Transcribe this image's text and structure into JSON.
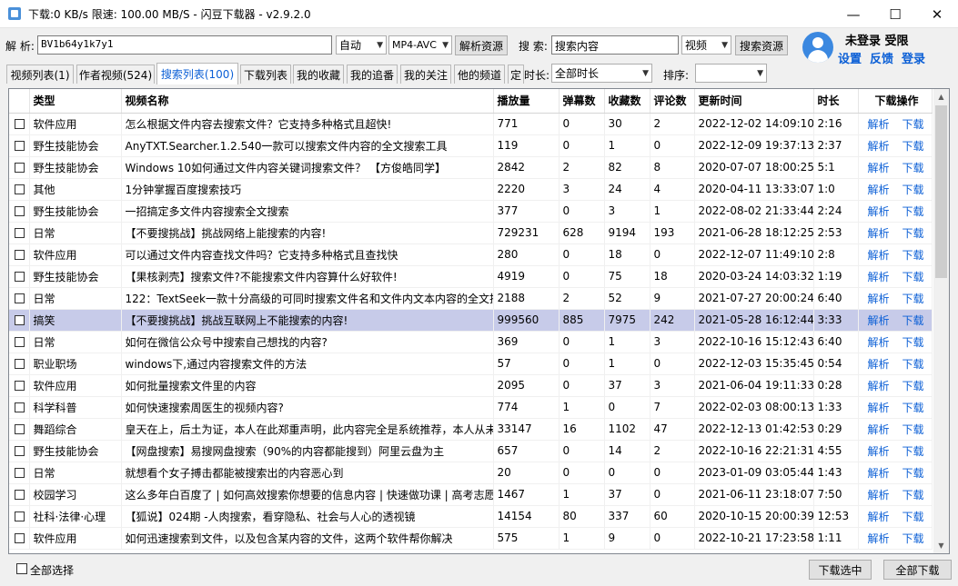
{
  "titlebar": {
    "title": "下载:0 KB/s   限速: 100.00 MB/S  - 闪豆下载器 - v2.9.2.0",
    "minimize": "—",
    "maximize": "☐",
    "close": "✕"
  },
  "parse": {
    "label": "解 析:",
    "value": "BV1b64y1k7y1",
    "mode": "自动",
    "format": "MP4-AVC",
    "button": "解析资源"
  },
  "search": {
    "label": "搜 索:",
    "value": "搜索内容",
    "type": "视频",
    "button": "搜索资源"
  },
  "user": {
    "status": "未登录 受限",
    "settings": "设置",
    "feedback": "反馈",
    "login": "登录"
  },
  "tabs": [
    {
      "label": "视频列表(1)"
    },
    {
      "label": "作者视频(524)"
    },
    {
      "label": "搜索列表(100)"
    },
    {
      "label": "下载列表"
    },
    {
      "label": "我的收藏"
    },
    {
      "label": "我的追番"
    },
    {
      "label": "我的关注"
    },
    {
      "label": "他的频道"
    },
    {
      "label": "定"
    }
  ],
  "filters": {
    "duration_label": "时长:",
    "duration_value": "全部时长",
    "sort_label": "排序:",
    "sort_value": ""
  },
  "table": {
    "headers": [
      "类型",
      "视频名称",
      "播放量",
      "弹幕数",
      "收藏数",
      "评论数",
      "更新时间",
      "时长",
      "下载操作"
    ],
    "action_parse": "解析",
    "action_download": "下载",
    "rows": [
      [
        "软件应用",
        "怎么根据文件内容去搜索文件？它支持多种格式且超快!",
        "771",
        "0",
        "30",
        "2",
        "2022-12-02 14:09:10",
        "2:16"
      ],
      [
        "野生技能协会",
        "AnyTXT.Searcher.1.2.540一款可以搜索文件内容的全文搜索工具",
        "119",
        "0",
        "1",
        "0",
        "2022-12-09 19:37:13",
        "2:37"
      ],
      [
        "野生技能协会",
        "Windows 10如何通过文件内容关键词搜索文件？ 【方俊皓同学】",
        "2842",
        "2",
        "82",
        "8",
        "2020-07-07 18:00:25",
        "5:1"
      ],
      [
        "其他",
        "1分钟掌握百度搜索技巧",
        "2220",
        "3",
        "24",
        "4",
        "2020-04-11 13:33:07",
        "1:0"
      ],
      [
        "野生技能协会",
        "一招搞定多文件内容搜索全文搜索",
        "377",
        "0",
        "3",
        "1",
        "2022-08-02 21:33:44",
        "2:24"
      ],
      [
        "日常",
        "【不要搜挑战】挑战网络上能搜索的内容!",
        "729231",
        "628",
        "9194",
        "193",
        "2021-06-28 18:12:25",
        "2:53"
      ],
      [
        "软件应用",
        "可以通过文件内容查找文件吗？它支持多种格式且查找快",
        "280",
        "0",
        "18",
        "0",
        "2022-12-07 11:49:10",
        "2:8"
      ],
      [
        "野生技能协会",
        "【果核剥壳】搜索文件?不能搜索文件内容算什么好软件!",
        "4919",
        "0",
        "75",
        "18",
        "2020-03-24 14:03:32",
        "1:19"
      ],
      [
        "日常",
        "122：TextSeek一款十分高级的可同时搜索文件名和文件内文本内容的全文搜",
        "2188",
        "2",
        "52",
        "9",
        "2021-07-27 20:00:24",
        "6:40"
      ],
      [
        "搞笑",
        "【不要搜挑战】挑战互联网上不能搜索的内容!",
        "999560",
        "885",
        "7975",
        "242",
        "2021-05-28 16:12:44",
        "3:33"
      ],
      [
        "日常",
        "如何在微信公众号中搜索自己想找的内容?",
        "369",
        "0",
        "1",
        "3",
        "2022-10-16 15:12:43",
        "6:40"
      ],
      [
        "职业职场",
        "windows下,通过内容搜索文件的方法",
        "57",
        "0",
        "1",
        "0",
        "2022-12-03 15:35:45",
        "0:54"
      ],
      [
        "软件应用",
        "如何批量搜索文件里的内容",
        "2095",
        "0",
        "37",
        "3",
        "2021-06-04 19:11:33",
        "0:28"
      ],
      [
        "科学科普",
        "如何快速搜索周医生的视频内容?",
        "774",
        "1",
        "0",
        "7",
        "2022-02-03 08:00:13",
        "1:33"
      ],
      [
        "舞蹈综合",
        "皇天在上，后土为证，本人在此郑重声明，此内容完全是系统推荐，本人从未",
        "33147",
        "16",
        "1102",
        "47",
        "2022-12-13 01:42:53",
        "0:29"
      ],
      [
        "野生技能协会",
        "【网盘搜索】易搜网盘搜索（90%的内容都能搜到）阿里云盘为主",
        "657",
        "0",
        "14",
        "2",
        "2022-10-16 22:21:31",
        "4:55"
      ],
      [
        "日常",
        "就想看个女子搏击都能被搜索出的内容恶心到",
        "20",
        "0",
        "0",
        "0",
        "2023-01-09 03:05:44",
        "1:43"
      ],
      [
        "校园学习",
        "这么多年白百度了 | 如何高效搜索你想要的信息内容 | 快速做功课 | 高考志愿",
        "1467",
        "1",
        "37",
        "0",
        "2021-06-11 23:18:07",
        "7:50"
      ],
      [
        "社科·法律·心理",
        "【狐说】024期 -人肉搜索，看穿隐私、社会与人心的透视镜",
        "14154",
        "80",
        "337",
        "60",
        "2020-10-15 20:00:39",
        "12:53"
      ],
      [
        "软件应用",
        "如何迅速搜索到文件，以及包含某内容的文件，这两个软件帮你解决",
        "575",
        "1",
        "9",
        "0",
        "2022-10-21 17:23:58",
        "1:11"
      ]
    ]
  },
  "bottom": {
    "select_all": "全部选择",
    "download_selected": "下载选中",
    "download_all": "全部下载"
  },
  "icons": {
    "scroll_up": "chevron-up-icon",
    "scroll_down": "chevron-down-icon",
    "avatar": "user-avatar-icon"
  },
  "colors": {
    "link_blue": "#0b5fd6",
    "selected_row": "#c7cbe9",
    "avatar_blue": "#3b88e0"
  }
}
